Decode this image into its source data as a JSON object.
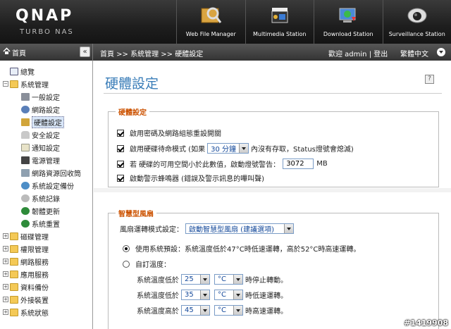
{
  "header": {
    "logo": "QNAP",
    "logo_sub": "TURBO NAS",
    "apps": [
      {
        "label": "Web File Manager",
        "icon": "web-file-manager-icon"
      },
      {
        "label": "Multimedia Station",
        "icon": "multimedia-station-icon"
      },
      {
        "label": "Download Station",
        "icon": "download-station-icon"
      },
      {
        "label": "Surveillance Station",
        "icon": "surveillance-station-icon"
      }
    ]
  },
  "breadcrumb": {
    "home": "首頁",
    "collapse": "«",
    "path": "首頁 >> 系統管理 >> 硬體設定",
    "user": "歡迎 admin | 登出",
    "language": "繁體中文"
  },
  "sidebar": {
    "items": [
      {
        "label": "總覽"
      },
      {
        "label": "系統管理"
      },
      {
        "label": "一般設定"
      },
      {
        "label": "網路設定"
      },
      {
        "label": "硬體設定"
      },
      {
        "label": "安全設定"
      },
      {
        "label": "通知設定"
      },
      {
        "label": "電源管理"
      },
      {
        "label": "網路資源回收筒"
      },
      {
        "label": "系統設定備份"
      },
      {
        "label": "系統記錄"
      },
      {
        "label": "韌體更新"
      },
      {
        "label": "系統重置"
      },
      {
        "label": "磁碟管理"
      },
      {
        "label": "權限管理"
      },
      {
        "label": "網路服務"
      },
      {
        "label": "應用服務"
      },
      {
        "label": "資料備份"
      },
      {
        "label": "外接裝置"
      },
      {
        "label": "系統狀態"
      }
    ]
  },
  "main": {
    "title": "硬體設定",
    "hardware": {
      "legend": "硬體設定",
      "opt1": "啟用密碼及網路組態重設開關",
      "opt2_pre": "啟用硬碟待命模式 (如果",
      "opt2_select": "30 分鐘",
      "opt2_post": "內沒有存取，Status燈號會熄滅)",
      "opt3_pre": "若 硬碟的可用空間小於此數值，啟動燈號警告：",
      "opt3_value": "3072",
      "opt3_unit": "MB",
      "opt4": "啟動警示蜂鳴器 (錯誤及警示訊息的嗶叫聲)"
    },
    "fan": {
      "legend": "智慧型風扇",
      "mode_label": "風扇運轉模式設定：",
      "mode_value": "啟動智慧型風扇 (建議選項)",
      "default_opt": "使用系統預設：系統溫度低於47°C時低速運轉，高於52°C時高速運轉。",
      "custom_opt": "自訂溫度：",
      "rows": [
        {
          "pre": "系統溫度低於",
          "temp": "25",
          "unit": "°C",
          "post": "時停止轉動。"
        },
        {
          "pre": "系統溫度低於",
          "temp": "35",
          "unit": "°C",
          "post": "時低速運轉。"
        },
        {
          "pre": "系統溫度高於",
          "temp": "45",
          "unit": "°C",
          "post": "時高速運轉。"
        }
      ]
    }
  },
  "watermark": "#1419908"
}
